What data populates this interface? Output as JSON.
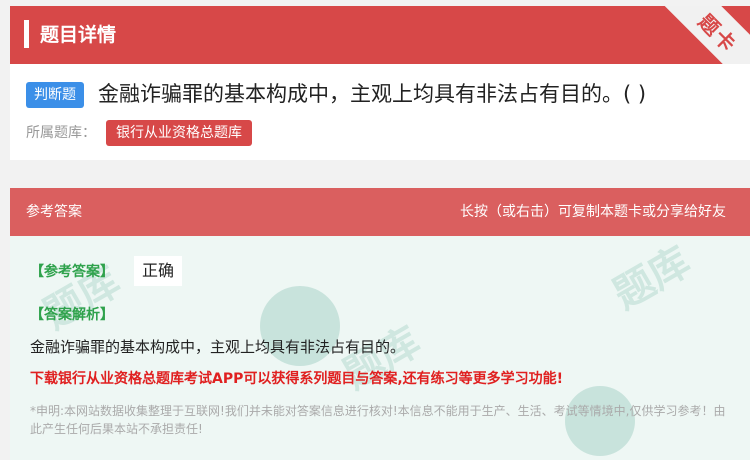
{
  "header": {
    "title": "题目详情",
    "corner_badge": "题卡"
  },
  "question": {
    "type_tag": "判断题",
    "text": "金融诈骗罪的基本构成中，主观上均具有非法占有目的。( )",
    "library_label": "所属题库：",
    "library_name": "银行从业资格总题库"
  },
  "answer_section": {
    "header_left": "参考答案",
    "header_right": "长按（或右击）可复制本题卡或分享给好友",
    "answer_label": "【参考答案】",
    "answer_value": "正确",
    "explanation_label": "【答案解析】",
    "explanation_text": "金融诈骗罪的基本构成中，主观上均具有非法占有目的。",
    "promo_text": "下载银行从业资格总题库考试APP可以获得系列题目与答案,还有练习等更多学习功能!",
    "disclaimer": "*申明:本网站数据收集整理于互联网!我们并未能对答案信息进行核对!本信息不能用于生产、生活、考试等情境中,仅供学习参考！由此产生任何后果本站不承担责任!"
  },
  "colors": {
    "brand_red": "#d74848",
    "type_blue": "#3b8fe8",
    "answer_green": "#2fa24c",
    "promo_red": "#e02020"
  }
}
